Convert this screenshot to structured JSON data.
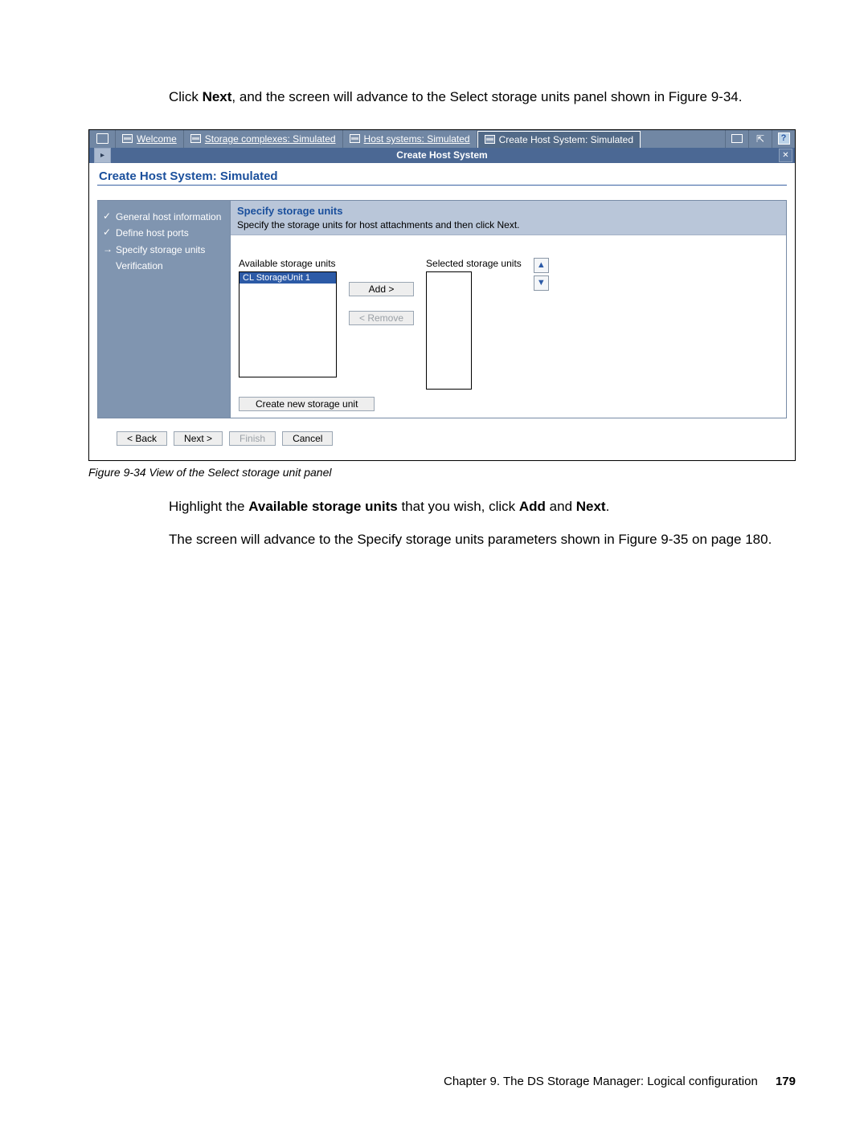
{
  "intro": {
    "line1_pre": "Click ",
    "line1_bold": "Next",
    "line1_post": ", and the screen will advance to the Select storage units panel shown in Figure 9-34."
  },
  "tabs": {
    "welcome": "Welcome",
    "storage_complexes": "Storage complexes: Simulated",
    "host_systems": "Host systems: Simulated",
    "create_host": "Create Host System: Simulated"
  },
  "toolbar_title": "Create Host System",
  "page_title_blue": "Create Host System: Simulated",
  "steps": {
    "s1": "General host information",
    "s2": "Define host ports",
    "s3": "Specify storage units",
    "s4": "Verification"
  },
  "panel": {
    "heading": "Specify storage units",
    "sub": "Specify the storage units for host attachments and then click Next.",
    "available_label": "Available storage units",
    "selected_label": "Selected storage units",
    "available_item": "CL  StorageUnit 1",
    "add": "Add >",
    "remove": "< Remove",
    "create_new": "Create new storage unit"
  },
  "wizard_buttons": {
    "back": "< Back",
    "next": "Next >",
    "finish": "Finish",
    "cancel": "Cancel"
  },
  "caption": "Figure 9-34   View of the Select storage unit panel",
  "para2": {
    "pre": "Highlight the ",
    "b1": "Available storage units",
    "mid": " that you wish, click ",
    "b2": "Add",
    "mid2": " and ",
    "b3": "Next",
    "post": "."
  },
  "para3": "The screen will advance to the Specify storage units parameters shown in Figure 9-35 on page 180.",
  "footer": {
    "chapter": "Chapter 9. The DS Storage Manager: Logical configuration",
    "page": "179"
  }
}
